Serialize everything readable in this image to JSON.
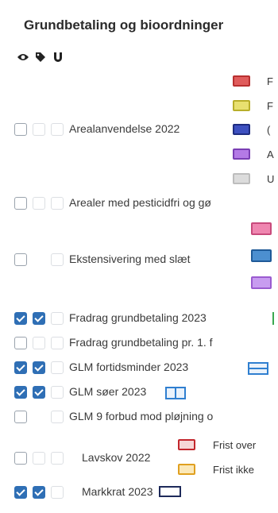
{
  "title": "Grundbetaling og bioordninger",
  "header_icons": [
    "eye-icon",
    "tag-icon",
    "magnet-icon"
  ],
  "layers": [
    {
      "label": "Arealanvendelse 2022",
      "visible": false,
      "checked2": false
    },
    {
      "label": "Arealer med pesticidfri og gø",
      "visible": false,
      "checked2": false
    },
    {
      "label": "Ekstensivering med slæt",
      "visible": false,
      "checked2": false
    },
    {
      "label": "Fradrag grundbetaling 2023",
      "visible": true,
      "checked2": true
    },
    {
      "label": "Fradrag grundbetaling pr. 1. f",
      "visible": false,
      "checked2": false
    },
    {
      "label": "GLM fortidsminder 2023",
      "visible": true,
      "checked2": true
    },
    {
      "label": "GLM søer 2023",
      "visible": true,
      "checked2": true
    },
    {
      "label": "GLM 9 forbud mod pløjning o",
      "visible": false,
      "checked2": false
    },
    {
      "label": "Lavskov 2022",
      "visible": false,
      "checked2": false
    },
    {
      "label": "Markkrat 2023",
      "visible": true,
      "checked2": true
    }
  ],
  "legend": {
    "areal": [
      {
        "color": "#d94a4a",
        "fill": "#e05c5c",
        "text": "F"
      },
      {
        "color": "#c9c23a",
        "fill": "#e8e070",
        "text": "F"
      },
      {
        "color": "#2a3b9c",
        "fill": "#3d50c0",
        "text": "("
      },
      {
        "color": "#8a48c8",
        "fill": "#b47ae6",
        "text": "A"
      },
      {
        "color": "#c8c8c8",
        "fill": "#dcdcdc",
        "text": "U"
      }
    ],
    "ekst": [
      {
        "color": "#d8588a",
        "fill": "#ef86b0"
      },
      {
        "color": "#2a6db0",
        "fill": "#4c8fd0"
      },
      {
        "color": "#9b5bd0",
        "fill": "#c89cf0"
      }
    ],
    "lavskov": [
      {
        "color": "#c2272d",
        "fill": "#f6d7d7",
        "text": "Frist over"
      },
      {
        "color": "#e0a020",
        "fill": "#fbe8b8",
        "text": "Frist ikke"
      }
    ]
  }
}
